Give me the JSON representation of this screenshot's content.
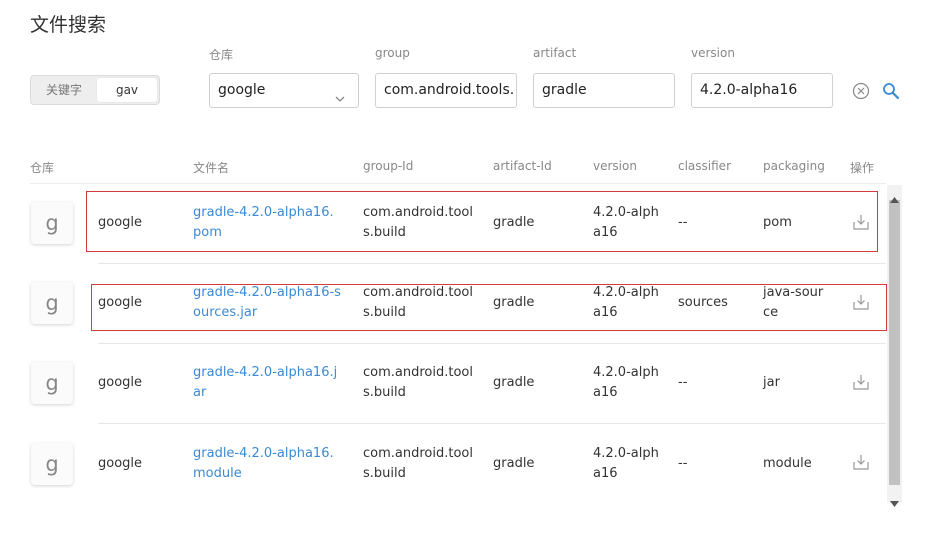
{
  "page_title": "文件搜索",
  "mode_toggle": {
    "keyword": "关键字",
    "gav": "gav",
    "selected": "gav"
  },
  "filters": {
    "repo": {
      "label": "仓库",
      "value": "google"
    },
    "group": {
      "label": "group",
      "value": "com.android.tools."
    },
    "artifact": {
      "label": "artifact",
      "value": "gradle"
    },
    "version": {
      "label": "version",
      "value": "4.2.0-alpha16"
    }
  },
  "icons": {
    "clear": "clear-circle-icon",
    "search": "search-icon",
    "download": "download-icon",
    "select": "chevron-down-icon"
  },
  "colors": {
    "link": "#3a8ad6",
    "highlight": "#d23c3c",
    "search_icon": "#3a8ad6"
  },
  "table": {
    "headers": {
      "repo": "仓库",
      "filename": "文件名",
      "group_id": "group-Id",
      "artifact_id": "artifact-Id",
      "version": "version",
      "classifier": "classifier",
      "packaging": "packaging",
      "actions": "操作"
    },
    "rows": [
      {
        "avatar": "g",
        "repo": "google",
        "filename": "gradle-4.2.0-alpha16.pom",
        "group_id": "com.android.tools.build",
        "artifact_id": "gradle",
        "version": "4.2.0-alpha16",
        "classifier": "--",
        "packaging": "pom"
      },
      {
        "avatar": "g",
        "repo": "google",
        "filename": "gradle-4.2.0-alpha16-sources.jar",
        "group_id": "com.android.tools.build",
        "artifact_id": "gradle",
        "version": "4.2.0-alpha16",
        "classifier": "sources",
        "packaging": "java-source"
      },
      {
        "avatar": "g",
        "repo": "google",
        "filename": "gradle-4.2.0-alpha16.jar",
        "group_id": "com.android.tools.build",
        "artifact_id": "gradle",
        "version": "4.2.0-alpha16",
        "classifier": "--",
        "packaging": "jar"
      },
      {
        "avatar": "g",
        "repo": "google",
        "filename": "gradle-4.2.0-alpha16.module",
        "group_id": "com.android.tools.build",
        "artifact_id": "gradle",
        "version": "4.2.0-alpha16",
        "classifier": "--",
        "packaging": "module"
      }
    ]
  }
}
